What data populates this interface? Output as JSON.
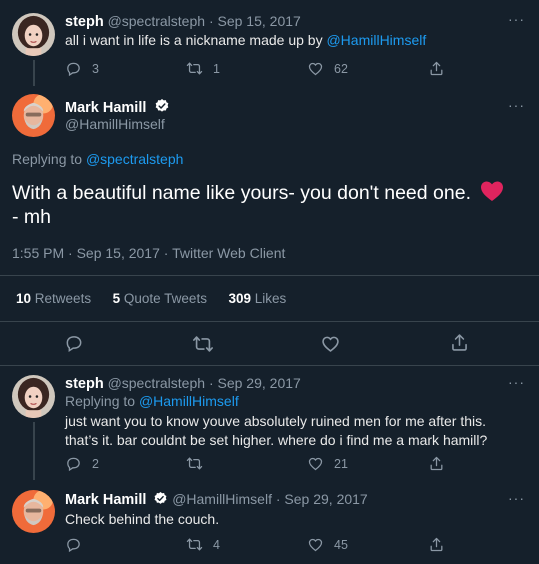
{
  "tweet1": {
    "name": "steph",
    "handle": "@spectralsteph",
    "sep": "·",
    "date": "Sep 15, 2017",
    "text_prefix": "all i want in life is a nickname made up by ",
    "text_mention": "@HamillHimself",
    "replies": "3",
    "retweets": "1",
    "likes": "62"
  },
  "main": {
    "name": "Mark Hamill",
    "handle": "@HamillHimself",
    "replying_label": "Replying to ",
    "replying_to": "@spectralsteph",
    "text_line1": "With a beautiful name like yours- you don't need one.",
    "text_line2": "- mh",
    "meta": "1:55 PM · Sep 15, 2017 · Twitter Web Client",
    "retweets_count": "10",
    "retweets_label": "Retweets",
    "quotes_count": "5",
    "quotes_label": "Quote Tweets",
    "likes_count": "309",
    "likes_label": "Likes"
  },
  "reply1": {
    "name": "steph",
    "handle": "@spectralsteph",
    "sep": "·",
    "date": "Sep 29, 2017",
    "replying_label": "Replying to ",
    "replying_to": "@HamillHimself",
    "text_line1": "just want you to know youve absolutely ruined men for me after this.",
    "text_line2": "that’s it. bar couldnt be set higher. where do i find me a mark hamill?",
    "replies": "2",
    "likes": "21"
  },
  "reply2": {
    "name": "Mark Hamill",
    "handle": "@HamillHimself",
    "sep": "·",
    "date": "Sep 29, 2017",
    "text": "Check behind the couch.",
    "retweets": "4",
    "likes": "45"
  },
  "more_label": "···",
  "colors": {
    "background": "#15202b",
    "accent": "#1d9bf0",
    "muted": "#8b98a5",
    "heart": "#e0245e"
  },
  "icons": [
    "reply-icon",
    "retweet-icon",
    "like-icon",
    "share-icon",
    "more-icon",
    "verified-badge-icon",
    "heart-emoji"
  ]
}
